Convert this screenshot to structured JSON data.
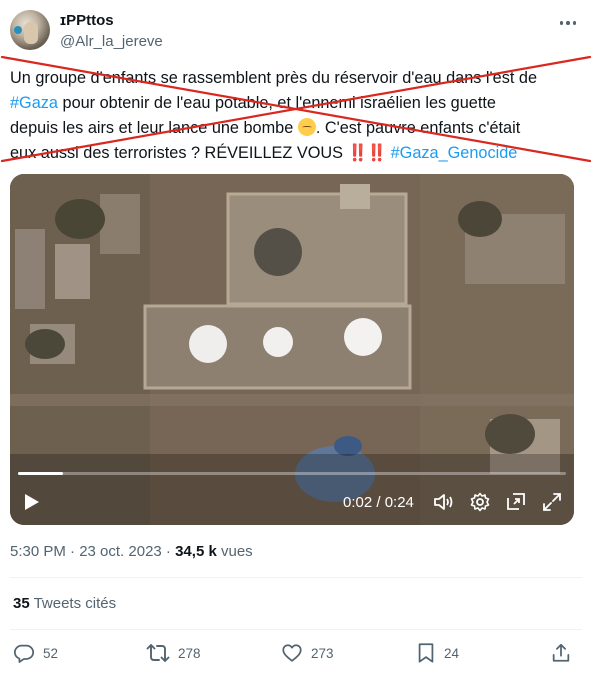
{
  "author": {
    "name": "ɪPPttos",
    "handle": "@Alr_la_jereve"
  },
  "tweet": {
    "line1": "Un groupe d'enfants se rassemblent près du réservoir d'eau dans l'est de",
    "hashtag_gaza": "#Gaza",
    "line2_rest": " pour obtenir de l'eau potable, et l'ennemi israélien les guette",
    "line3_a": "depuis les airs et leur lance une bombe ",
    "line3_b": ". C'est pauvre enfants c'était",
    "line4_a": "eux aussi des terroristes ? RÉVEILLEZ VOUS ",
    "bangs": "‼️‼️",
    "hashtag_genocide": "#Gaza_Genocide"
  },
  "video": {
    "time": "0:02 / 0:24",
    "progress": 0.083
  },
  "meta": {
    "time_date": "5:30 PM · 23 oct. 2023 · ",
    "views_count": "34,5 k",
    "views_label": " vues"
  },
  "quotes": {
    "count": "35",
    "label": " Tweets cités"
  },
  "actions": {
    "replies": "52",
    "retweets": "278",
    "likes": "273",
    "bookmarks": "24"
  },
  "colors": {
    "accent": "#1d9bf0",
    "strike": "#d9281f",
    "muted": "#536471"
  },
  "icons": [
    "more-icon",
    "play-icon",
    "volume-icon",
    "settings-icon",
    "pip-icon",
    "fullscreen-icon",
    "reply-icon",
    "retweet-icon",
    "like-icon",
    "bookmark-icon",
    "share-icon"
  ]
}
